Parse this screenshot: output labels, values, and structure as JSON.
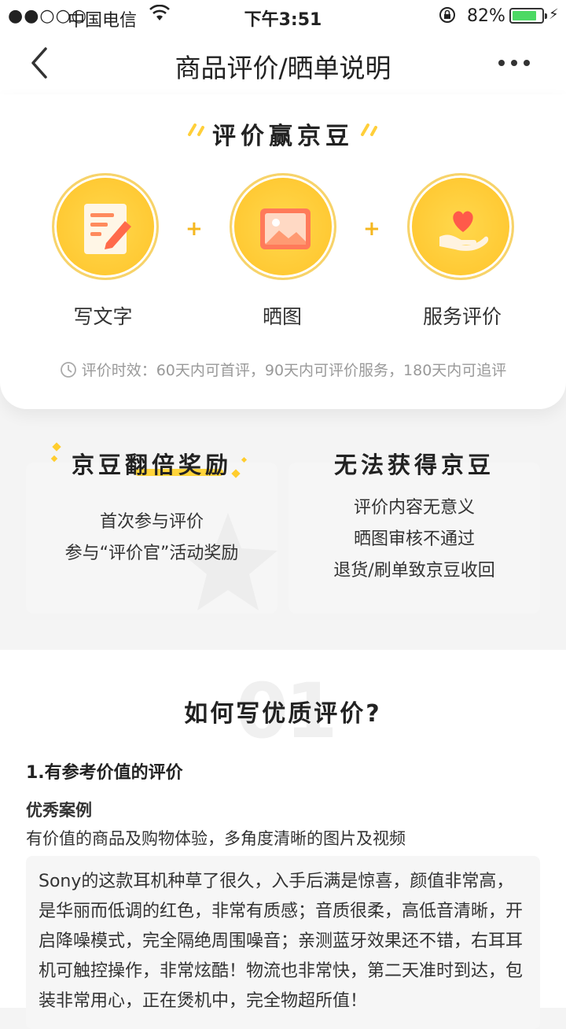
{
  "status_bar": {
    "signal": "●●○○○",
    "carrier": "中国电信",
    "time": "下午3:51",
    "battery_pct": "82%",
    "battery_level": 0.82
  },
  "nav": {
    "title": "商品评价/晒单说明",
    "back_icon": "chevron-left-icon",
    "more_icon": "more-dots-icon"
  },
  "promo": {
    "heading": "评价赢京豆",
    "items": [
      {
        "label": "写文字",
        "icon": "write-text-icon"
      },
      {
        "label": "晒图",
        "icon": "photo-icon"
      },
      {
        "label": "服务评价",
        "icon": "heart-hand-icon"
      }
    ],
    "plus": "+",
    "note": "评价时效：60天内可首评，90天内可评价服务，180天内可追评"
  },
  "rewards": {
    "double": {
      "title": "京豆翻倍奖励",
      "lines": [
        "首次参与评价",
        "参与“评价官”活动奖励"
      ]
    },
    "none": {
      "title": "无法获得京豆",
      "lines": [
        "评价内容无意义",
        "晒图审核不通过",
        "退货/刷单致京豆收回"
      ]
    }
  },
  "guide": {
    "bg_number": "01",
    "title": "如何写优质评价?",
    "sub_heading": "1.有参考价值的评价",
    "example_label": "优秀案例",
    "example_desc": "有价值的商品及购物体验，多角度清晰的图片及视频",
    "example_text": "Sony的这款耳机种草了很久，入手后满是惊喜，颜值非常高，是华丽而低调的红色，非常有质感；音质很柔，高低音清晰，开启降噪模式，完全隔绝周围噪音；亲测蓝牙效果还不错，右耳耳机可触控操作，非常炫酷！物流也非常快，第二天准时到达，包装非常用心，正在煲机中，完全物超所值！"
  },
  "colors": {
    "accent": "#ffc933",
    "plus": "#f5b71f",
    "underline": "#ffd43b"
  }
}
